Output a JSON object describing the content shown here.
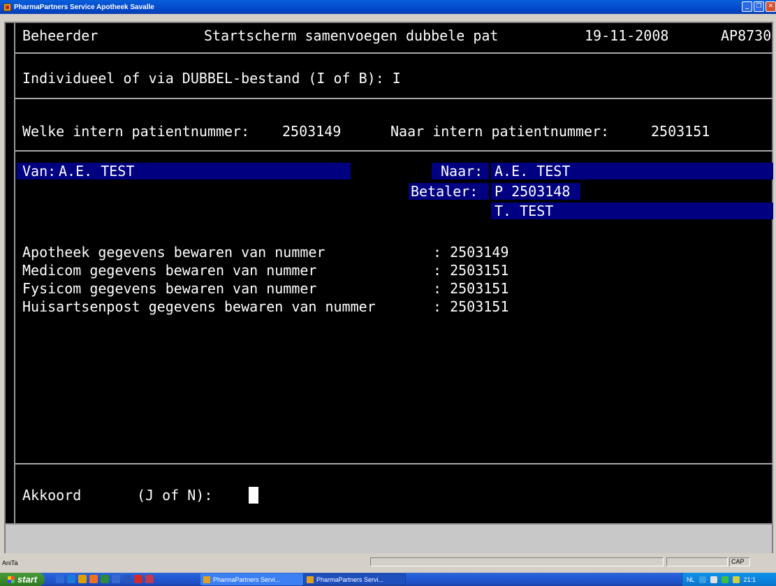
{
  "window": {
    "title": "PharmaPartners Service Apotheek Savalle",
    "minimize_glyph": "_",
    "maximize_glyph": "❐",
    "close_glyph": "✕"
  },
  "terminal": {
    "header": {
      "user": "Beheerder",
      "screen_title": "Startscherm samenvoegen dubbele pat",
      "date": "19-11-2008",
      "code": "AP8730"
    },
    "mode_line": "Individueel of via DUBBEL-bestand (I of B): I",
    "patient_numbers": {
      "from_label": "Welke intern patientnummer:",
      "from_value": "2503149",
      "to_label": "Naar intern patientnummer:",
      "to_value": "2503151"
    },
    "van": {
      "label": "Van:",
      "name": "A.E. TEST"
    },
    "naar": {
      "label": "Naar:",
      "name": "A.E. TEST"
    },
    "betaler": {
      "label": "Betaler:",
      "number": "P 2503148",
      "name": "T. TEST"
    },
    "keep_rows": [
      {
        "label": "Apotheek gegevens bewaren van nummer       ",
        "value": ": 2503149"
      },
      {
        "label": "Medicom gegevens bewaren van nummer        ",
        "value": ": 2503151"
      },
      {
        "label": "Fysicom gegevens bewaren van nummer        ",
        "value": ": 2503151"
      },
      {
        "label": "Huisartsenpost gegevens bewaren van nummer ",
        "value": ": 2503151"
      }
    ],
    "confirm": {
      "label": "Akkoord",
      "prompt": "(J of N):"
    }
  },
  "statusbar": {
    "user": "AniTa",
    "cap": "CAP"
  },
  "taskbar": {
    "start_label": "start",
    "tasks": [
      "PharmaPartners Servi...",
      "PharmaPartners Servi..."
    ],
    "tray_lang": "NL",
    "clock": "21:1"
  },
  "colors": {
    "terminal_bg": "#000000",
    "terminal_text": "#ffffff",
    "highlight": "#000080",
    "titlebar": "#0450d1"
  }
}
